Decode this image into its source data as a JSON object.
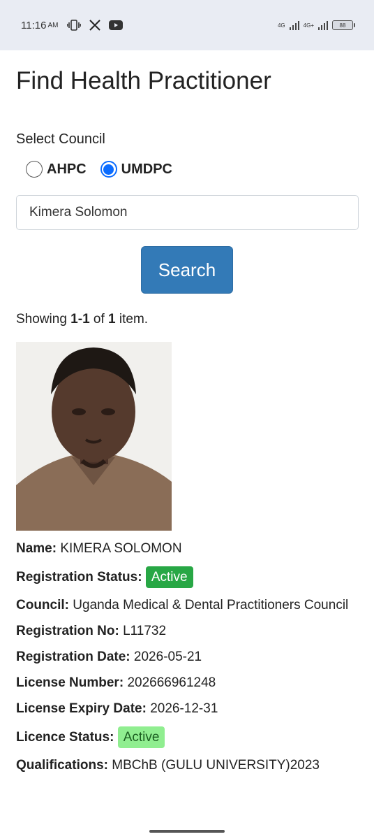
{
  "status_bar": {
    "time": "11:16",
    "ampm": "AM",
    "icons": [
      "vibrate-icon",
      "x-logo-icon",
      "youtube-icon"
    ],
    "network1": "4G",
    "network2": "4G+",
    "battery": "88"
  },
  "page": {
    "title": "Find Health Practitioner",
    "select_label": "Select Council",
    "councils": [
      {
        "label": "AHPC",
        "checked": false
      },
      {
        "label": "UMDPC",
        "checked": true
      }
    ],
    "search_value": "Kimera Solomon",
    "search_button": "Search",
    "summary": {
      "prefix": "Showing ",
      "range": "1-1",
      "mid": " of ",
      "total": "1",
      "suffix": " item."
    }
  },
  "practitioner": {
    "photo_alt": "practitioner photo",
    "fields": {
      "name_label": "Name:",
      "name": "KIMERA SOLOMON",
      "reg_status_label": "Registration Status:",
      "reg_status": "Active",
      "council_label": "Council:",
      "council": "Uganda Medical & Dental Practitioners Council",
      "reg_no_label": "Registration No:",
      "reg_no": "L11732",
      "reg_date_label": "Registration Date:",
      "reg_date": "2026-05-21",
      "license_no_label": "License Number:",
      "license_no": "202666961248",
      "expiry_label": "License Expiry Date:",
      "expiry": "2026-12-31",
      "licence_status_label": "Licence Status:",
      "licence_status": "Active",
      "qual_label": "Qualifications:",
      "qual": "MBChB (GULU UNIVERSITY)2023"
    }
  },
  "colors": {
    "primary_button": "#337ab7",
    "active_badge": "#28a745",
    "licence_badge": "#90ee90",
    "radio_selected": "#0b6cff",
    "status_bar_bg": "#e9ecf3"
  }
}
